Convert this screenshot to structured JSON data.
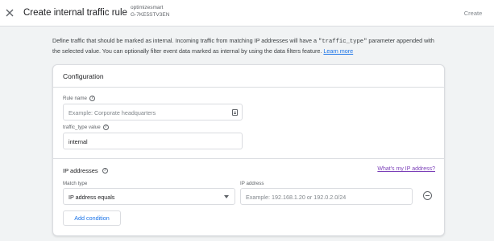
{
  "header": {
    "title": "Create internal traffic rule",
    "account_name": "optimizesmart",
    "stream_id": "G-7KE5STV3EN",
    "create_label": "Create",
    "close_icon": "close-icon"
  },
  "description": {
    "text_before": "Define traffic that should be marked as internal. Incoming traffic from matching IP addresses will have a ",
    "code": "\"traffic_type\"",
    "text_after": " parameter appended with the selected value. You can optionally filter event data marked as internal by using the data filters feature. ",
    "link_label": "Learn more"
  },
  "configuration": {
    "title": "Configuration",
    "rule_name": {
      "label": "Rule name",
      "value": "",
      "placeholder": "Example: Corporate headquarters"
    },
    "traffic_type": {
      "label": "traffic_type value",
      "value": "internal",
      "placeholder": ""
    }
  },
  "ip_addresses": {
    "title": "IP addresses",
    "help_link": "What's my IP address?",
    "match_type_label": "Match type",
    "match_type_value": "IP address equals",
    "ip_label": "IP address",
    "ip_value": "",
    "ip_placeholder": "Example: 192.168.1.20 or 192.0.2.0/24",
    "add_condition_label": "Add condition"
  },
  "colors": {
    "link": "#1a73e8",
    "visited_link": "#7b3fb8",
    "border": "#dadce0",
    "background": "#f1f3f4"
  }
}
